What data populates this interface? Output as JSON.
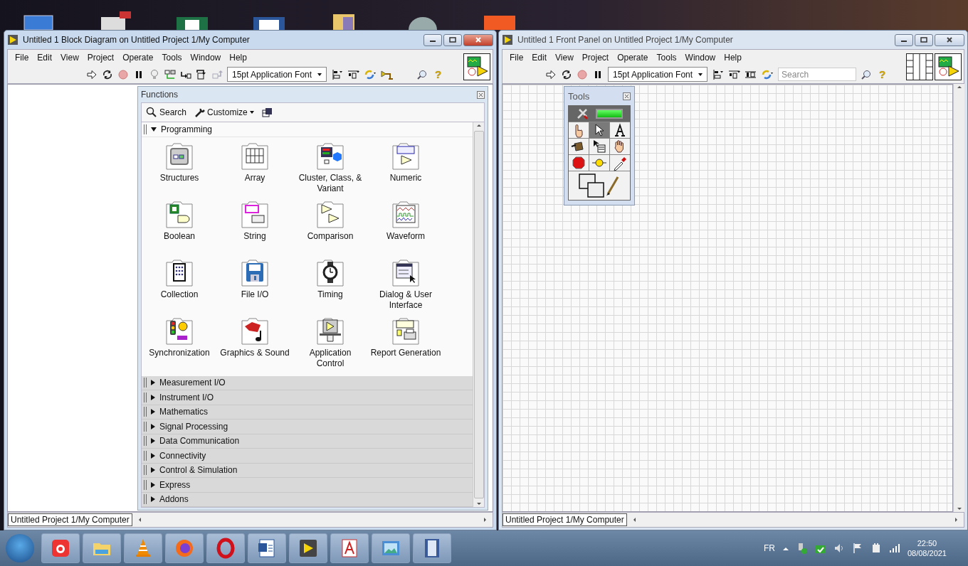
{
  "block_diagram_window": {
    "title": "Untitled 1 Block Diagram on Untitled Project 1/My Computer",
    "active": true,
    "menu": [
      "File",
      "Edit",
      "View",
      "Project",
      "Operate",
      "Tools",
      "Window",
      "Help"
    ],
    "font_selector": "15pt Application Font",
    "help": "?",
    "status_bar": "Untitled Project 1/My Computer"
  },
  "functions_palette": {
    "title": "Functions",
    "search_button": "Search",
    "customize_button": "Customize",
    "categories": [
      {
        "label": "Programming",
        "expanded": true,
        "items": [
          {
            "label": "Structures"
          },
          {
            "label": "Array"
          },
          {
            "label": "Cluster, Class, & Variant"
          },
          {
            "label": "Numeric"
          },
          {
            "label": "Boolean"
          },
          {
            "label": "String"
          },
          {
            "label": "Comparison"
          },
          {
            "label": "Waveform"
          },
          {
            "label": "Collection"
          },
          {
            "label": "File I/O"
          },
          {
            "label": "Timing"
          },
          {
            "label": "Dialog & User Interface"
          },
          {
            "label": "Synchronization"
          },
          {
            "label": "Graphics & Sound"
          },
          {
            "label": "Application Control"
          },
          {
            "label": "Report Generation"
          }
        ]
      },
      {
        "label": "Measurement I/O",
        "expanded": false
      },
      {
        "label": "Instrument I/O",
        "expanded": false
      },
      {
        "label": "Mathematics",
        "expanded": false
      },
      {
        "label": "Signal Processing",
        "expanded": false
      },
      {
        "label": "Data Communication",
        "expanded": false
      },
      {
        "label": "Connectivity",
        "expanded": false
      },
      {
        "label": "Control & Simulation",
        "expanded": false
      },
      {
        "label": "Express",
        "expanded": false
      },
      {
        "label": "Addons",
        "expanded": false
      }
    ]
  },
  "front_panel_window": {
    "title": "Untitled 1 Front Panel on Untitled Project 1/My Computer",
    "active": false,
    "menu": [
      "File",
      "Edit",
      "View",
      "Project",
      "Operate",
      "Tools",
      "Window",
      "Help"
    ],
    "font_selector": "15pt Application Font",
    "search": {
      "placeholder": "Search"
    },
    "help": "?",
    "status_bar": "Untitled Project 1/My Computer"
  },
  "tools_palette": {
    "title": "Tools",
    "auto_tool": {
      "on": true
    },
    "tools": [
      {
        "selected": false
      },
      {
        "selected": true
      },
      {
        "selected": false
      },
      {
        "selected": false
      },
      {
        "selected": false
      },
      {
        "selected": false
      },
      {
        "selected": false
      },
      {
        "selected": false
      },
      {
        "selected": false
      },
      {
        "selected": false
      }
    ]
  },
  "tray": {
    "language": "FR",
    "time": "22:50",
    "date": "08/08/2021"
  }
}
